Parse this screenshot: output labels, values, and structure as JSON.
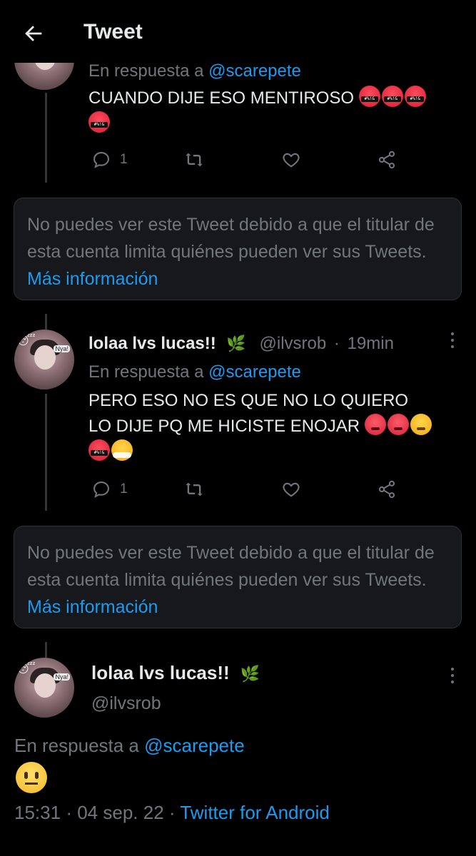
{
  "header": {
    "title": "Tweet"
  },
  "tweet1": {
    "reply_prefix": "En respuesta a",
    "reply_handle": "@scarepete",
    "text": "CUANDO DIJE ESO MENTIROSO",
    "emojis": [
      "cursing-face",
      "cursing-face",
      "cursing-face",
      "cursing-face"
    ],
    "reply_count": "1"
  },
  "limited1": {
    "text": "No puedes ver este Tweet debido a que el titular de esta cuenta limita quiénes pueden ver sus Tweets.",
    "link": "Más información"
  },
  "tweet2": {
    "author_name": "lolaa lvs lucas!!",
    "author_emoji": "🌿",
    "handle": "@ilvsrob",
    "separator": "·",
    "time": "19min",
    "reply_prefix": "En respuesta a",
    "reply_handle": "@scarepete",
    "text_line1": "PERO ESO NO ES QUE NO LO QUIERO",
    "text_line2": "LO DIJE PQ ME HICISTE ENOJAR",
    "emojis": [
      "pouting-face",
      "pouting-face",
      "angry-face",
      "cursing-face",
      "face-with-steam"
    ],
    "reply_count": "1"
  },
  "limited2": {
    "text": "No puedes ver este Tweet debido a que el titular de esta cuenta limita quiénes pueden ver sus Tweets.",
    "link": "Más información"
  },
  "main_tweet": {
    "author_name": "lolaa lvs lucas!!",
    "author_emoji": "🌿",
    "handle": "@ilvsrob",
    "reply_prefix": "En respuesta a",
    "reply_handle": "@scarepete",
    "emoji": "neutral-face",
    "time": "15:31",
    "date": "04 sep. 22",
    "separator": "·",
    "source": "Twitter for Android"
  },
  "avatar": {
    "tag": "Nya!",
    "emoji": "😴"
  },
  "colors": {
    "accent": "#1d9bf0",
    "muted": "#71767b",
    "background": "#000000",
    "card": "#16181c"
  }
}
